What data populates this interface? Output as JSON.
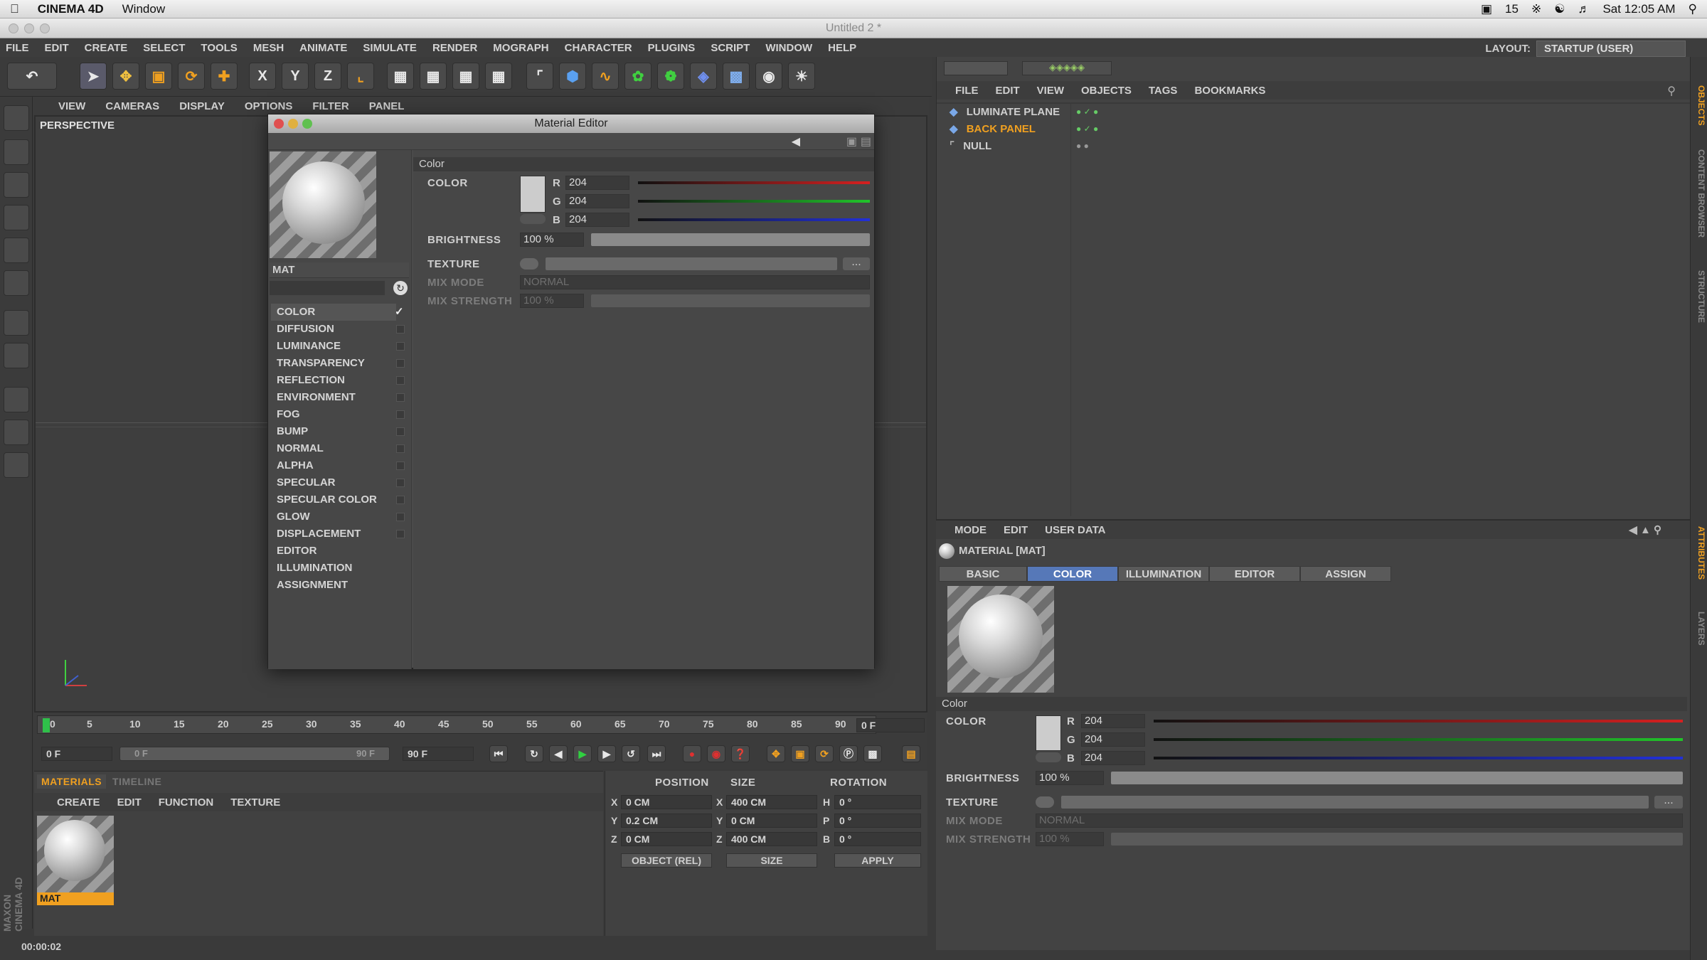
{
  "mac_menubar": {
    "app": "CINEMA 4D",
    "window_menu": "Window",
    "battery": "15",
    "clock": "Sat 12:05 AM"
  },
  "window_title": "Untitled 2 *",
  "menu": [
    "FILE",
    "EDIT",
    "CREATE",
    "SELECT",
    "TOOLS",
    "MESH",
    "ANIMATE",
    "SIMULATE",
    "RENDER",
    "MOGRAPH",
    "CHARACTER",
    "PLUGINS",
    "SCRIPT",
    "WINDOW",
    "HELP"
  ],
  "layout": {
    "label": "LAYOUT:",
    "value": "STARTUP (USER)"
  },
  "toolbar": {
    "x": "X",
    "y": "Y",
    "z": "Z"
  },
  "viewport": {
    "menu": [
      "VIEW",
      "CAMERAS",
      "DISPLAY",
      "OPTIONS",
      "FILTER",
      "PANEL"
    ],
    "label": "PERSPECTIVE"
  },
  "material_editor": {
    "title": "Material Editor",
    "material_name": "MAT",
    "channels": [
      "COLOR",
      "DIFFUSION",
      "LUMINANCE",
      "TRANSPARENCY",
      "REFLECTION",
      "ENVIRONMENT",
      "FOG",
      "BUMP",
      "NORMAL",
      "ALPHA",
      "SPECULAR",
      "SPECULAR COLOR",
      "GLOW",
      "DISPLACEMENT",
      "EDITOR",
      "ILLUMINATION",
      "ASSIGNMENT"
    ],
    "section": "Color",
    "color_label": "COLOR",
    "r_label": "R",
    "g_label": "G",
    "b_label": "B",
    "r": "204",
    "g": "204",
    "b": "204",
    "brightness_label": "BRIGHTNESS",
    "brightness": "100 %",
    "texture_label": "TEXTURE",
    "mix_mode_label": "MIX MODE",
    "mix_mode": "NORMAL",
    "mix_strength_label": "MIX STRENGTH",
    "mix_strength": "100 %"
  },
  "objects_panel": {
    "menu": [
      "FILE",
      "EDIT",
      "VIEW",
      "OBJECTS",
      "TAGS",
      "BOOKMARKS"
    ],
    "items": [
      "LUMINATE PLANE",
      "BACK PANEL",
      "NULL"
    ]
  },
  "side_tabs": [
    "OBJECTS",
    "CONTENT BROWSER",
    "STRUCTURE",
    "ATTRIBUTES",
    "LAYERS"
  ],
  "attributes": {
    "menu": [
      "MODE",
      "EDIT",
      "USER DATA"
    ],
    "header": "MATERIAL [MAT]",
    "tabs": [
      "BASIC",
      "COLOR",
      "ILLUMINATION",
      "EDITOR",
      "ASSIGN"
    ],
    "section": "Color",
    "color_label": "COLOR",
    "r": "204",
    "g": "204",
    "b": "204",
    "brightness_label": "BRIGHTNESS",
    "brightness": "100 %",
    "texture_label": "TEXTURE",
    "mix_mode_label": "MIX MODE",
    "mix_mode": "NORMAL",
    "mix_strength_label": "MIX STRENGTH",
    "mix_strength": "100 %"
  },
  "timeline": {
    "ticks": [
      "0",
      "5",
      "10",
      "15",
      "20",
      "25",
      "30",
      "35",
      "40",
      "45",
      "50",
      "55",
      "60",
      "65",
      "70",
      "75",
      "80",
      "85",
      "90"
    ],
    "current_frame": "0 F",
    "start": "0 F",
    "range_start": "0 F",
    "range_end": "90 F",
    "end": "90 F"
  },
  "materials_panel": {
    "tabs": [
      "MATERIALS",
      "TIMELINE"
    ],
    "menu": [
      "CREATE",
      "EDIT",
      "FUNCTION",
      "TEXTURE"
    ],
    "material": "MAT"
  },
  "coordinates": {
    "headers": [
      "POSITION",
      "SIZE",
      "ROTATION"
    ],
    "rows": [
      {
        "axis": "X",
        "pos": "0 CM",
        "size_axis": "X",
        "size": "400 CM",
        "rot_axis": "H",
        "rot": "0 °"
      },
      {
        "axis": "Y",
        "pos": "0.2 CM",
        "size_axis": "Y",
        "size": "0 CM",
        "rot_axis": "P",
        "rot": "0 °"
      },
      {
        "axis": "Z",
        "pos": "0 CM",
        "size_axis": "Z",
        "size": "400 CM",
        "rot_axis": "B",
        "rot": "0 °"
      }
    ],
    "mode": "OBJECT (REL)",
    "size_mode": "SIZE",
    "apply": "APPLY"
  },
  "status": {
    "time": "00:00:02",
    "brand": "MAXON CINEMA 4D"
  },
  "colors": {
    "red": "#d62020",
    "green": "#21c42a",
    "blue": "#2230d8",
    "accent": "#f0a020",
    "tab_active": "#5678b8"
  }
}
